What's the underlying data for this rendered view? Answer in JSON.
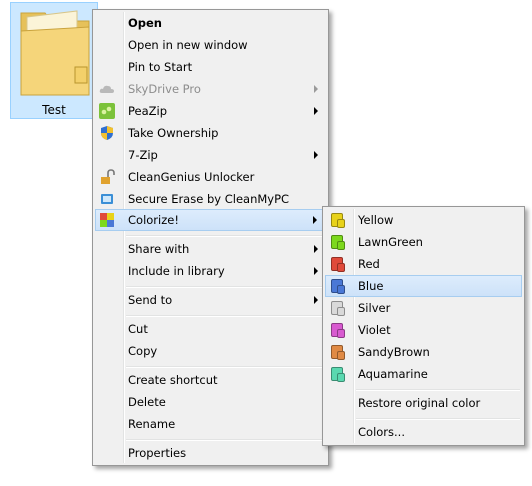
{
  "desktop": {
    "folder_label": "Test"
  },
  "main_menu": {
    "items": [
      {
        "label": "Open"
      },
      {
        "label": "Open in new window"
      },
      {
        "label": "Pin to Start"
      },
      {
        "label": "SkyDrive Pro"
      },
      {
        "label": "PeaZip"
      },
      {
        "label": "Take Ownership"
      },
      {
        "label": "7-Zip"
      },
      {
        "label": "CleanGenius Unlocker"
      },
      {
        "label": "Secure Erase by CleanMyPC"
      },
      {
        "label": "Colorize!"
      },
      {
        "label": "Share with"
      },
      {
        "label": "Include in library"
      },
      {
        "label": "Send to"
      },
      {
        "label": "Cut"
      },
      {
        "label": "Copy"
      },
      {
        "label": "Create shortcut"
      },
      {
        "label": "Delete"
      },
      {
        "label": "Rename"
      },
      {
        "label": "Properties"
      }
    ]
  },
  "colorize_menu": {
    "items": [
      {
        "label": "Yellow",
        "color": "#e8d21a"
      },
      {
        "label": "LawnGreen",
        "color": "#7cd81c"
      },
      {
        "label": "Red",
        "color": "#e04a3a"
      },
      {
        "label": "Blue",
        "color": "#4a78d6"
      },
      {
        "label": "Silver",
        "color": "#d9d9d9"
      },
      {
        "label": "Violet",
        "color": "#d85ad0"
      },
      {
        "label": "SandyBrown",
        "color": "#e08a44"
      },
      {
        "label": "Aquamarine",
        "color": "#5ad8b0"
      },
      {
        "label": "Restore original color"
      },
      {
        "label": "Colors..."
      }
    ]
  }
}
